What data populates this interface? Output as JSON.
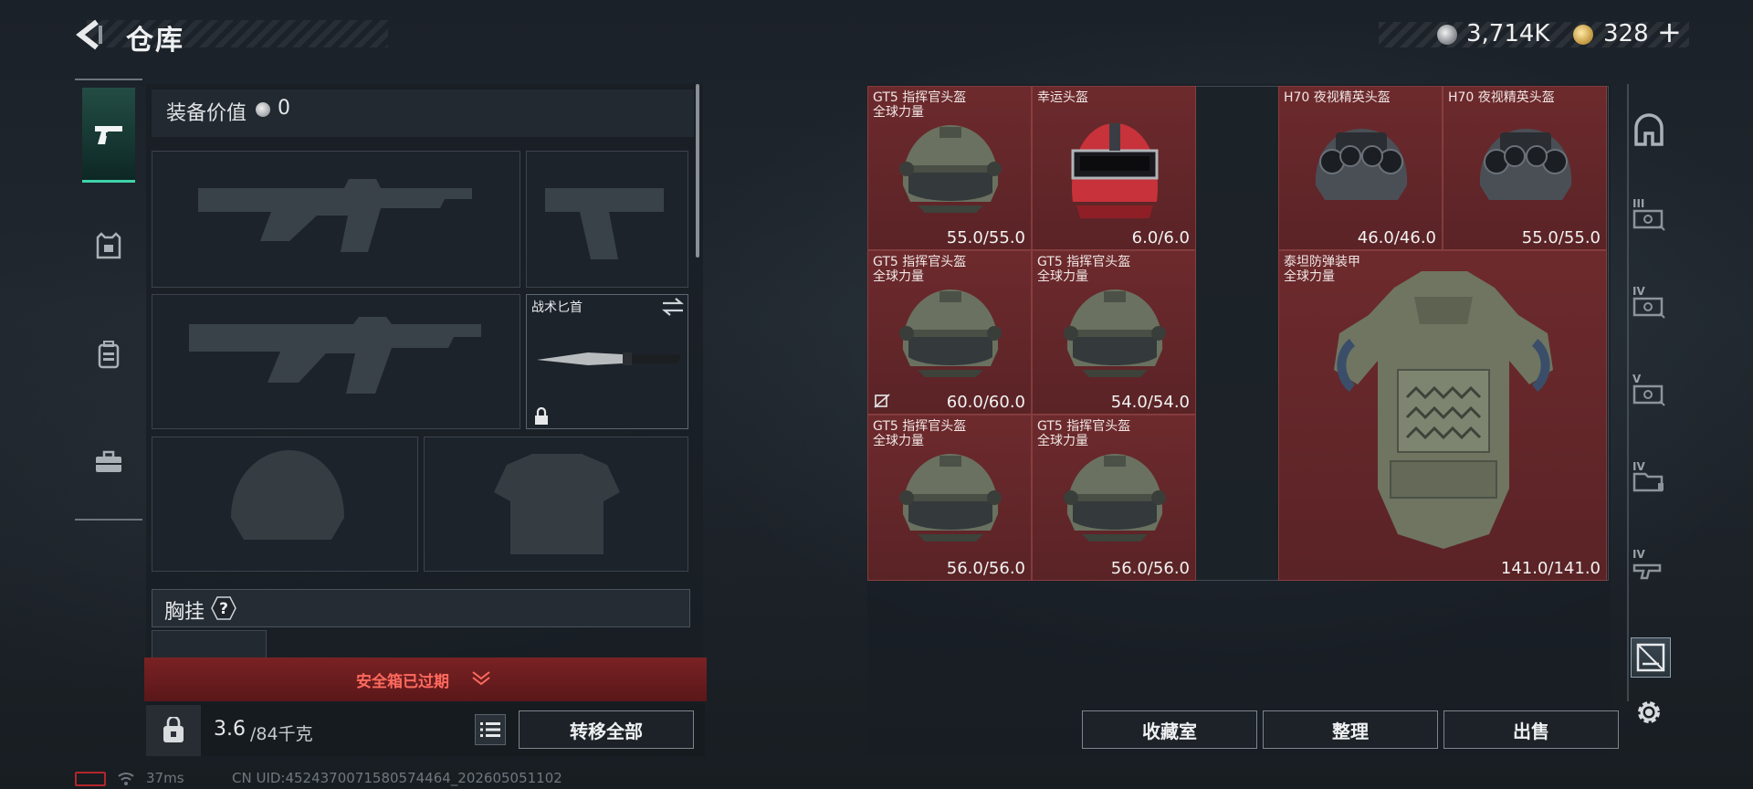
{
  "header": {
    "title": "仓库",
    "silver_value": "3,714K",
    "gold_value": "328",
    "gold_add": "+"
  },
  "left_tabs": [
    {
      "id": "weapons",
      "icon": "pistol-icon",
      "active": true
    },
    {
      "id": "armor",
      "icon": "armor-icon"
    },
    {
      "id": "backpack",
      "icon": "backpack-icon"
    },
    {
      "id": "kit",
      "icon": "briefcase-icon"
    }
  ],
  "equipment": {
    "value_label": "装备价值",
    "value": "0",
    "melee_name": "战术匕首",
    "chest_rig_label": "胸挂",
    "chest_rig_help": "?",
    "safebox_text": "安全箱已过期",
    "weight_current": "3.6",
    "weight_cap": "/84千克",
    "transfer_all_label": "转移全部"
  },
  "storage": {
    "items": [
      {
        "name": "GT5 指挥官头盔",
        "sub": "全球力量",
        "durability": "55.0/55.0"
      },
      {
        "name": "幸运头盔",
        "sub": "",
        "durability": "6.0/6.0"
      },
      {
        "name": "H70 夜视精英头盔",
        "sub": "",
        "durability": "46.0/46.0"
      },
      {
        "name": "H70 夜视精英头盔",
        "sub": "",
        "durability": "55.0/55.0"
      },
      {
        "name": "GT5 指挥官头盔",
        "sub": "全球力量",
        "durability": "60.0/60.0"
      },
      {
        "name": "GT5 指挥官头盔",
        "sub": "全球力量",
        "durability": "54.0/54.0"
      },
      {
        "name": "GT5 指挥官头盔",
        "sub": "全球力量",
        "durability": "56.0/56.0"
      },
      {
        "name": "GT5 指挥官头盔",
        "sub": "全球力量",
        "durability": "56.0/56.0"
      },
      {
        "name": "泰坦防弹装甲",
        "sub": "全球力量",
        "durability": "141.0/141.0"
      }
    ],
    "buttons": {
      "collection": "收藏室",
      "sort": "整理",
      "sell": "出售"
    }
  },
  "right_tabs": [
    {
      "id": "all",
      "level": ""
    },
    {
      "id": "tier3",
      "level": "III"
    },
    {
      "id": "tier4a",
      "level": "IV"
    },
    {
      "id": "tier5",
      "level": "V"
    },
    {
      "id": "tier4b",
      "level": "IV"
    },
    {
      "id": "tier4c",
      "level": "IV"
    },
    {
      "id": "active",
      "level": ""
    }
  ],
  "status": {
    "ping": "37ms",
    "uid": "CN UID:4524370071580574464_202605051102"
  },
  "colors": {
    "accent": "#3fd3a8",
    "item_bg": "#6d2a2d",
    "safebox": "#7a2224",
    "safebox_text": "#ff6a5e"
  }
}
